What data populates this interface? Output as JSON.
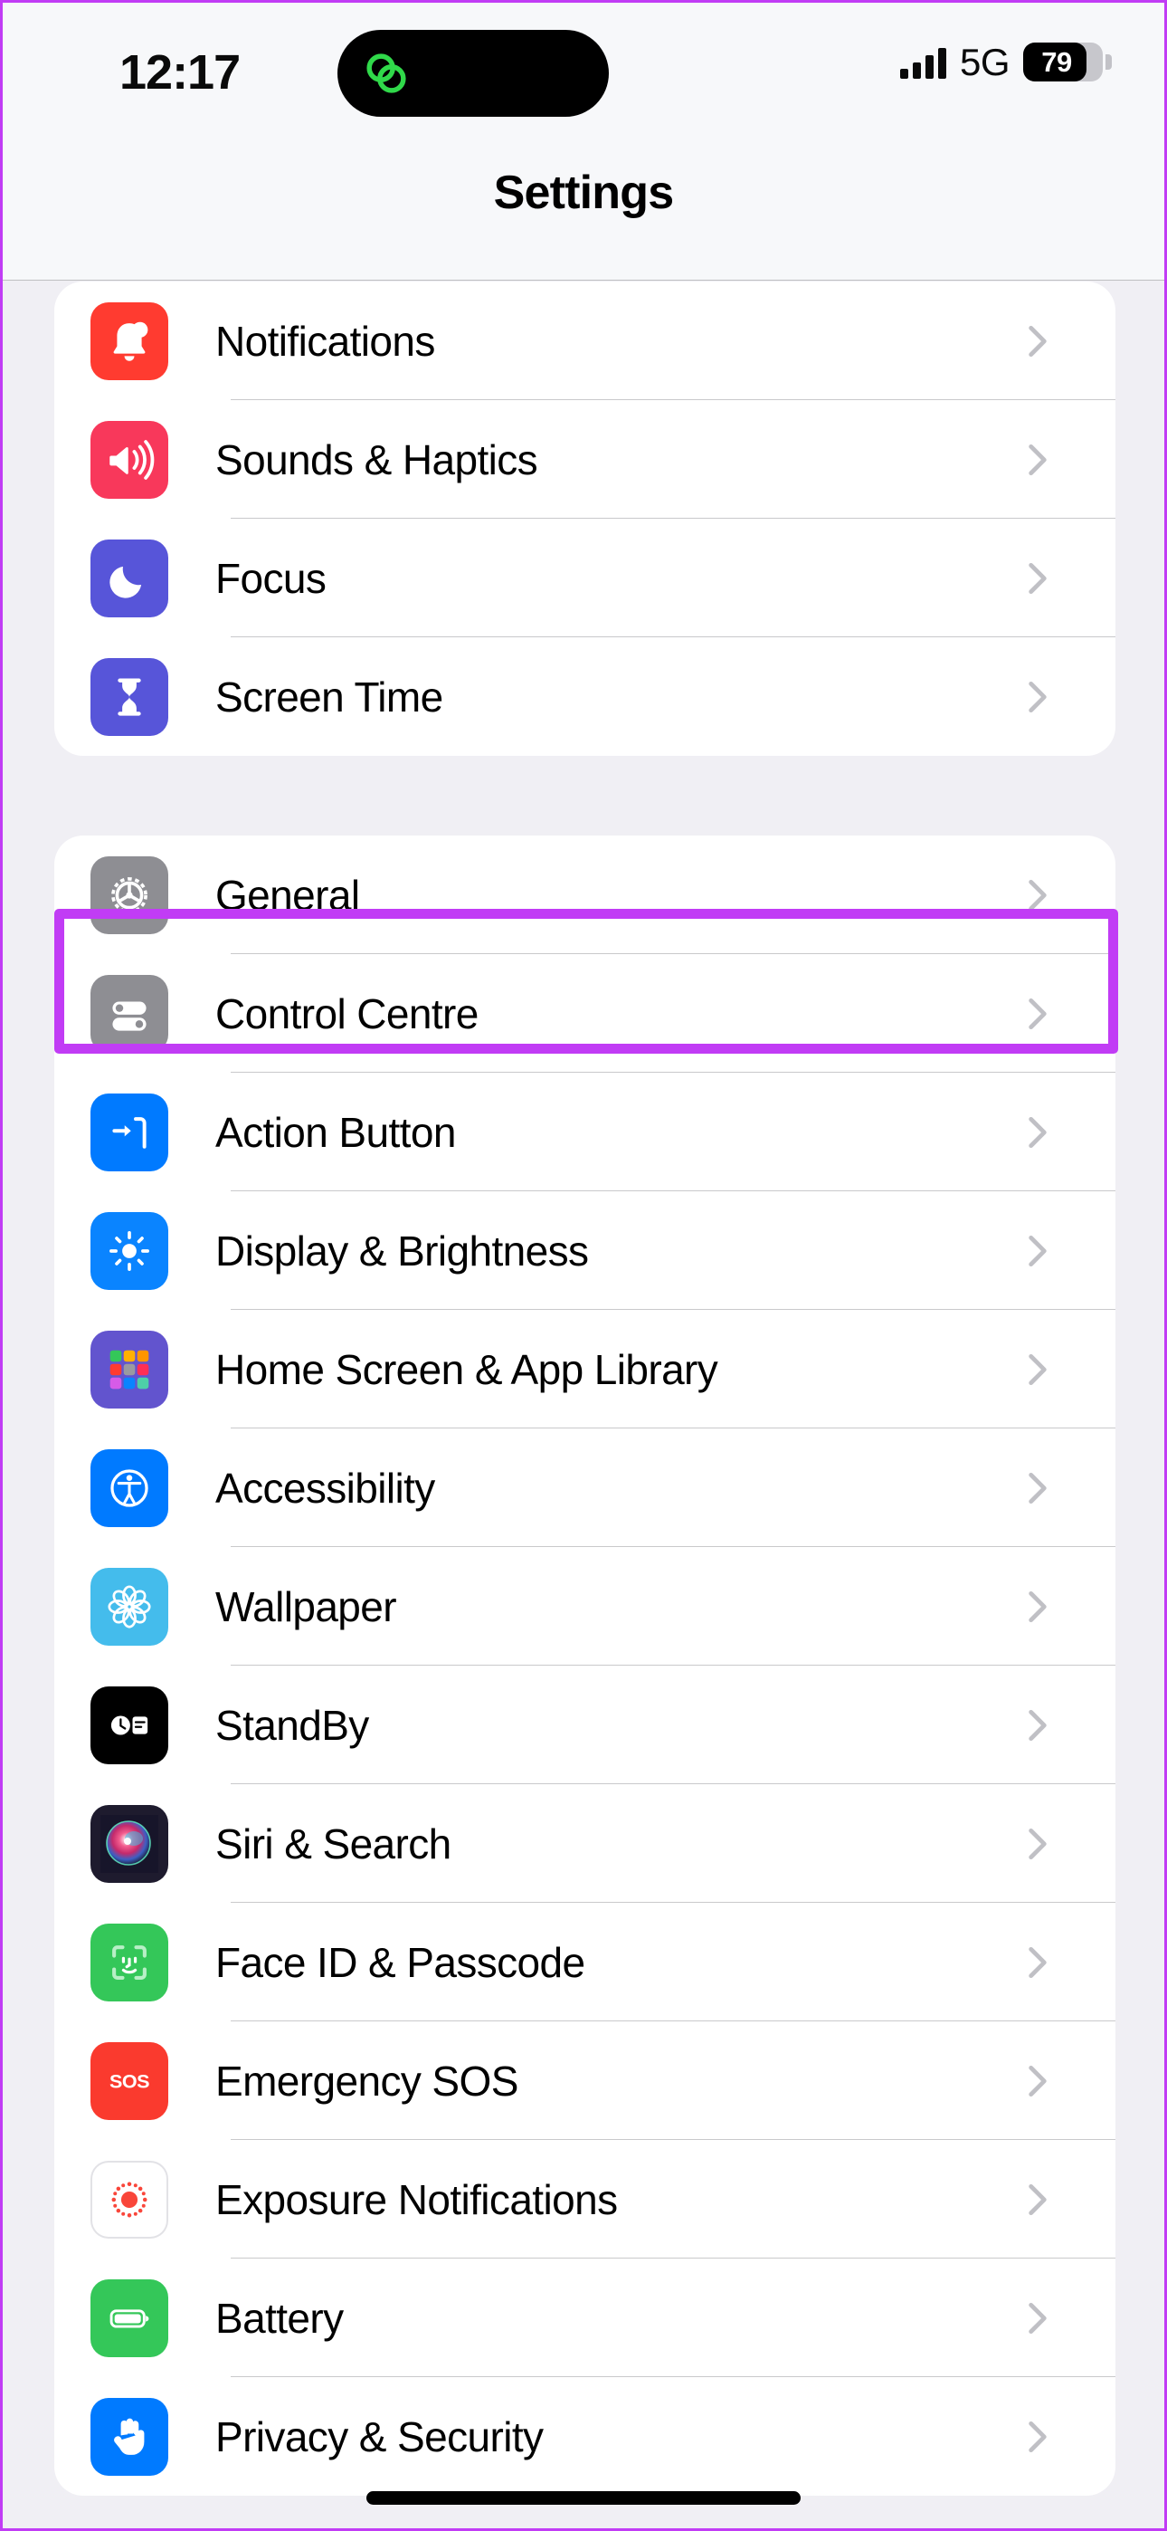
{
  "status_bar": {
    "time": "12:17",
    "network": "5G",
    "battery_percent": "79",
    "dynamic_island_icon": "link-circles-icon",
    "signal_icon": "cellular-signal-icon",
    "battery_icon": "battery-icon"
  },
  "header": {
    "title": "Settings"
  },
  "groups": [
    {
      "id": "group-1",
      "items": [
        {
          "label": "Notifications",
          "icon": "bell-icon",
          "icon_bg": "#FF3B30"
        },
        {
          "label": "Sounds & Haptics",
          "icon": "speaker-wave-icon",
          "icon_bg": "#F8385B"
        },
        {
          "label": "Focus",
          "icon": "moon-icon",
          "icon_bg": "#5755D9"
        },
        {
          "label": "Screen Time",
          "icon": "hourglass-icon",
          "icon_bg": "#5755D9"
        }
      ]
    },
    {
      "id": "group-2",
      "items": [
        {
          "label": "General",
          "icon": "gear-icon",
          "icon_bg": "#8E8E93"
        },
        {
          "label": "Control Centre",
          "icon": "sliders-icon",
          "icon_bg": "#8E8E93"
        },
        {
          "label": "Action Button",
          "icon": "action-button-icon",
          "icon_bg": "#007AFF"
        },
        {
          "label": "Display & Brightness",
          "icon": "sun-icon",
          "icon_bg": "#0A84FF",
          "highlighted": true
        },
        {
          "label": "Home Screen & App Library",
          "icon": "app-grid-icon",
          "icon_bg": "#6254CE"
        },
        {
          "label": "Accessibility",
          "icon": "accessibility-icon",
          "icon_bg": "#007AFF"
        },
        {
          "label": "Wallpaper",
          "icon": "flower-icon",
          "icon_bg": "#44BCEC"
        },
        {
          "label": "StandBy",
          "icon": "standby-clock-icon",
          "icon_bg": "#000000"
        },
        {
          "label": "Siri & Search",
          "icon": "siri-orb-icon",
          "icon_bg": "#1E1B2E"
        },
        {
          "label": "Face ID & Passcode",
          "icon": "face-id-icon",
          "icon_bg": "#34C759"
        },
        {
          "label": "Emergency SOS",
          "icon": "sos-icon",
          "icon_bg": "#FA3A2E"
        },
        {
          "label": "Exposure Notifications",
          "icon": "exposure-dots-icon",
          "icon_bg": "#FFFFFF"
        },
        {
          "label": "Battery",
          "icon": "battery-full-icon",
          "icon_bg": "#34C759"
        },
        {
          "label": "Privacy & Security",
          "icon": "hand-raised-icon",
          "icon_bg": "#007AFF"
        }
      ]
    }
  ],
  "annotation": {
    "target_label": "Display & Brightness",
    "color": "#C13CF5"
  },
  "home_indicator": "home-indicator"
}
